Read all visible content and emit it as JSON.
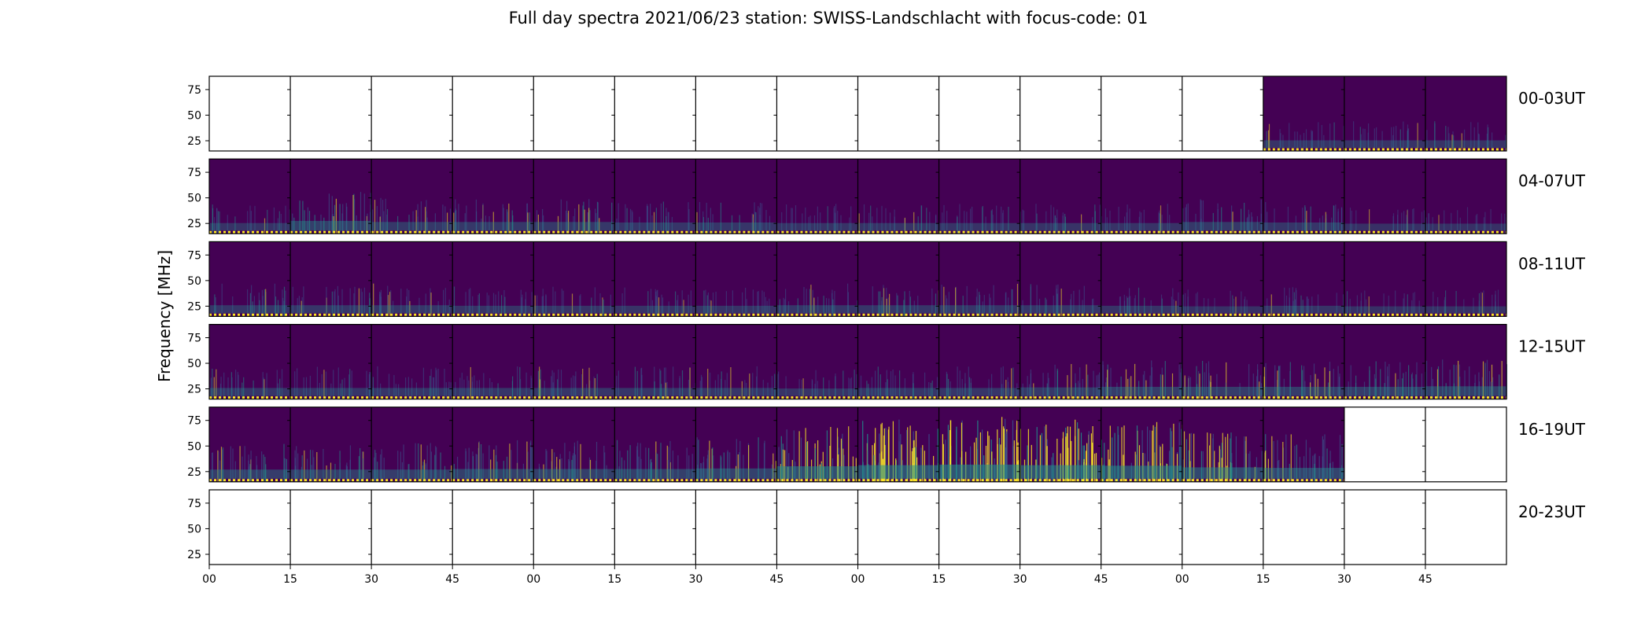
{
  "chart_data": {
    "type": "heatmap",
    "title": "Full day spectra 2021/06/23 station: SWISS-Landschlacht with focus-code: 01",
    "ylabel": "Frequency [MHz]",
    "xlabel": "",
    "y_ticks": [
      25,
      50,
      75
    ],
    "ylim": [
      15,
      88
    ],
    "x_tick_labels": [
      "00",
      "15",
      "30",
      "45",
      "00",
      "15",
      "30",
      "45",
      "00",
      "15",
      "30",
      "45",
      "00",
      "15",
      "30",
      "45"
    ],
    "colormap": [
      "#440154",
      "#3b528b",
      "#21918c",
      "#5ec962",
      "#fde725"
    ],
    "rows": [
      {
        "label": "00-03UT",
        "intensity": [
          null,
          null,
          null,
          null,
          null,
          null,
          null,
          null,
          null,
          null,
          null,
          null,
          null,
          0.25,
          0.25,
          0.25
        ]
      },
      {
        "label": "04-07UT",
        "intensity": [
          0.25,
          0.45,
          0.35,
          0.35,
          0.35,
          0.3,
          0.3,
          0.25,
          0.25,
          0.25,
          0.25,
          0.25,
          0.35,
          0.3,
          0.2,
          0.2
        ]
      },
      {
        "label": "08-11UT",
        "intensity": [
          0.3,
          0.3,
          0.3,
          0.25,
          0.25,
          0.25,
          0.25,
          0.3,
          0.3,
          0.3,
          0.3,
          0.25,
          0.2,
          0.25,
          0.2,
          0.2
        ]
      },
      {
        "label": "12-15UT",
        "intensity": [
          0.3,
          0.3,
          0.3,
          0.3,
          0.3,
          0.3,
          0.3,
          0.25,
          0.3,
          0.3,
          0.35,
          0.4,
          0.4,
          0.4,
          0.4,
          0.45
        ]
      },
      {
        "label": "16-19UT",
        "intensity": [
          0.4,
          0.4,
          0.4,
          0.45,
          0.45,
          0.45,
          0.5,
          0.7,
          0.8,
          0.85,
          0.8,
          0.75,
          0.6,
          0.55,
          null,
          null
        ]
      },
      {
        "label": "20-23UT",
        "intensity": [
          null,
          null,
          null,
          null,
          null,
          null,
          null,
          null,
          null,
          null,
          null,
          null,
          null,
          null,
          null,
          null
        ]
      }
    ]
  }
}
